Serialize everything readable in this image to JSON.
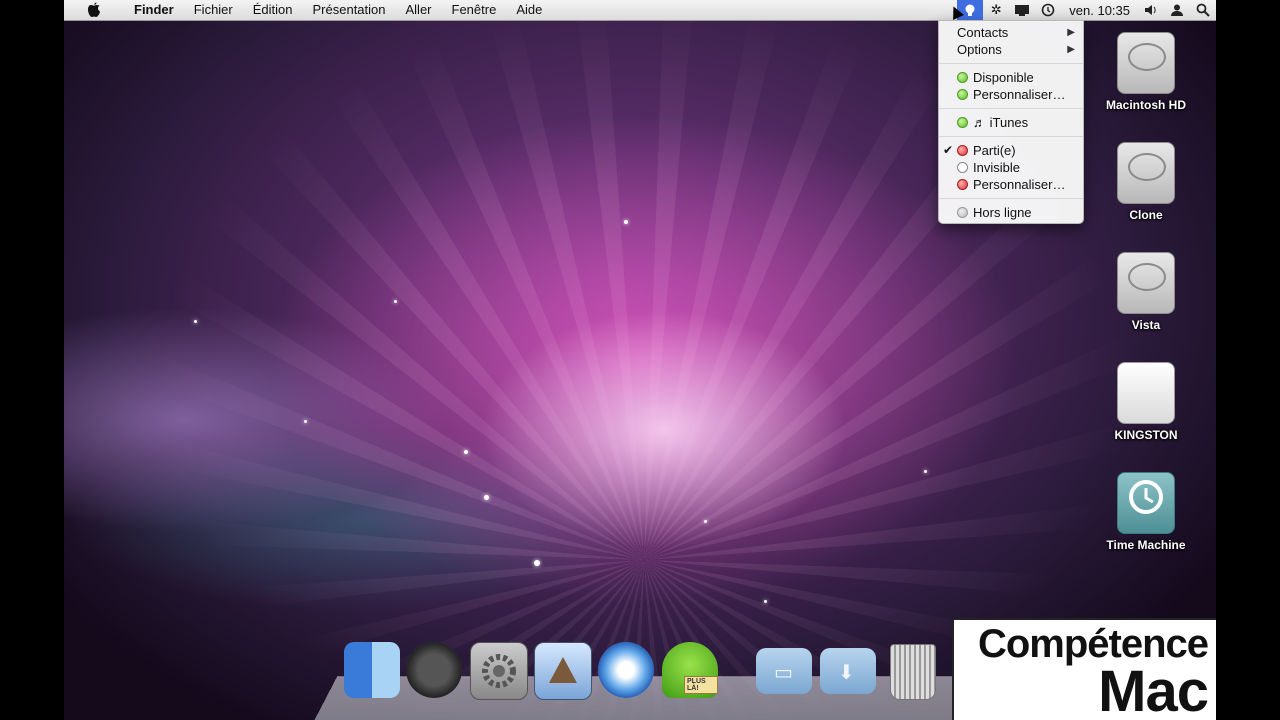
{
  "menubar": {
    "apple_icon": "apple-logo-icon",
    "items": [
      "Finder",
      "Fichier",
      "Édition",
      "Présentation",
      "Aller",
      "Fenêtre",
      "Aide"
    ],
    "status_icons": [
      "adium-status-icon",
      "brightness-icon",
      "display-icon",
      "time-machine-icon",
      "volume-icon",
      "user-icon",
      "spotlight-search-icon"
    ],
    "clock": "ven. 10:35"
  },
  "status_menu": {
    "contacts": "Contacts",
    "options": "Options",
    "available": "Disponible",
    "available_custom": "Personnaliser…",
    "itunes": "♬ iTunes",
    "away": "Parti(e)",
    "invisible": "Invisible",
    "away_custom": "Personnaliser…",
    "offline": "Hors ligne",
    "checked_item": "Parti(e)"
  },
  "desktop": {
    "icons": [
      {
        "label": "Macintosh HD",
        "kind": "hard-disk-icon"
      },
      {
        "label": "Clone",
        "kind": "hard-disk-icon"
      },
      {
        "label": "Vista",
        "kind": "hard-disk-icon"
      },
      {
        "label": "KINGSTON",
        "kind": "usb-drive-icon"
      },
      {
        "label": "Time Machine",
        "kind": "time-machine-drive-icon"
      }
    ]
  },
  "dock": {
    "items": [
      "finder-icon",
      "dashboard-icon",
      "system-preferences-icon",
      "mail-icon",
      "safari-icon",
      "adium-icon",
      "documents-folder-icon",
      "downloads-folder-icon",
      "trash-icon"
    ]
  },
  "adium_sign": "PLUS LÀ!",
  "watermark": {
    "line1": "Compétence",
    "line2": "Mac"
  },
  "colors": {
    "menu_highlight": "#3f6de0",
    "status_green": "#5cbf2a",
    "status_red": "#d93030"
  }
}
